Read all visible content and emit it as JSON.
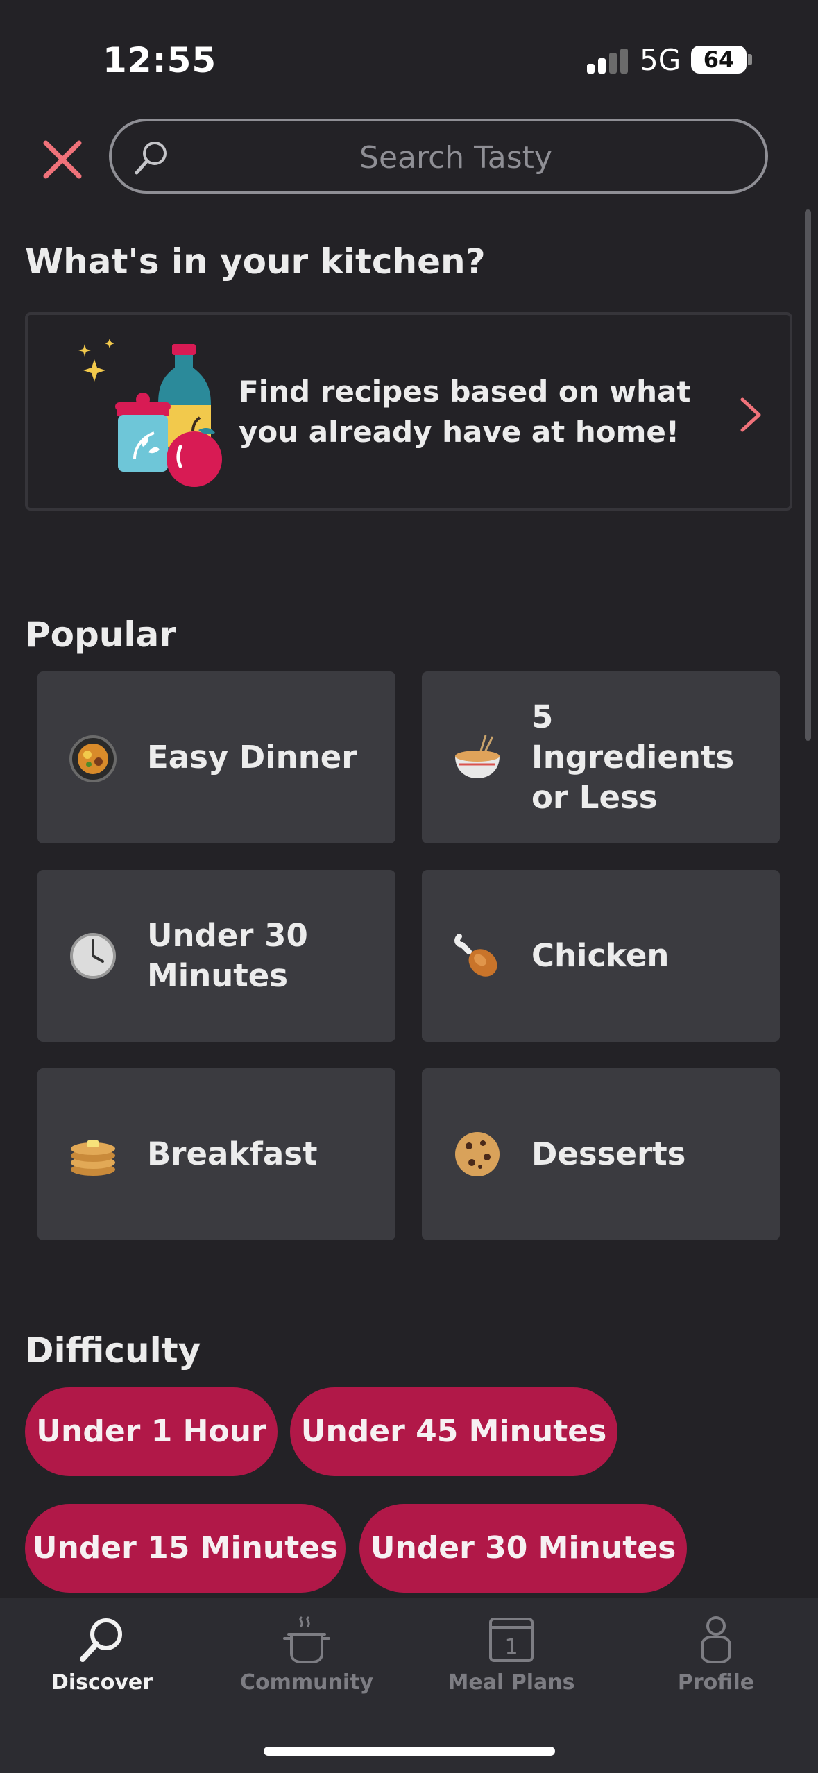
{
  "status_bar": {
    "time": "12:55",
    "network": "5G",
    "battery": "64"
  },
  "search": {
    "placeholder": "Search Tasty"
  },
  "kitchen": {
    "title": "What's in your kitchen?",
    "card_text": "Find recipes based on what you already have at home!"
  },
  "popular": {
    "title": "Popular",
    "items": [
      {
        "label": "Easy Dinner",
        "icon": "pan-dish-icon"
      },
      {
        "label": "5 Ingredients or Less",
        "icon": "noodle-bowl-icon"
      },
      {
        "label": "Under 30 Minutes",
        "icon": "clock-icon"
      },
      {
        "label": "Chicken",
        "icon": "drumstick-icon"
      },
      {
        "label": "Breakfast",
        "icon": "pancakes-icon"
      },
      {
        "label": "Desserts",
        "icon": "cookie-icon"
      }
    ]
  },
  "difficulty": {
    "title": "Difficulty",
    "items": [
      {
        "label": "Under 1 Hour"
      },
      {
        "label": "Under 45 Minutes"
      },
      {
        "label": "Under 15 Minutes"
      },
      {
        "label": "Under 30 Minutes"
      }
    ]
  },
  "tab_bar": {
    "tabs": [
      {
        "label": "Discover",
        "icon": "search-icon",
        "active": true
      },
      {
        "label": "Community",
        "icon": "pot-icon",
        "active": false
      },
      {
        "label": "Meal Plans",
        "icon": "calendar-icon",
        "active": false,
        "badge": "1"
      },
      {
        "label": "Profile",
        "icon": "person-icon",
        "active": false
      }
    ]
  },
  "colors": {
    "background": "#232226",
    "accent": "#b11848",
    "close": "#f0727a",
    "tile": "#3b3b40"
  }
}
